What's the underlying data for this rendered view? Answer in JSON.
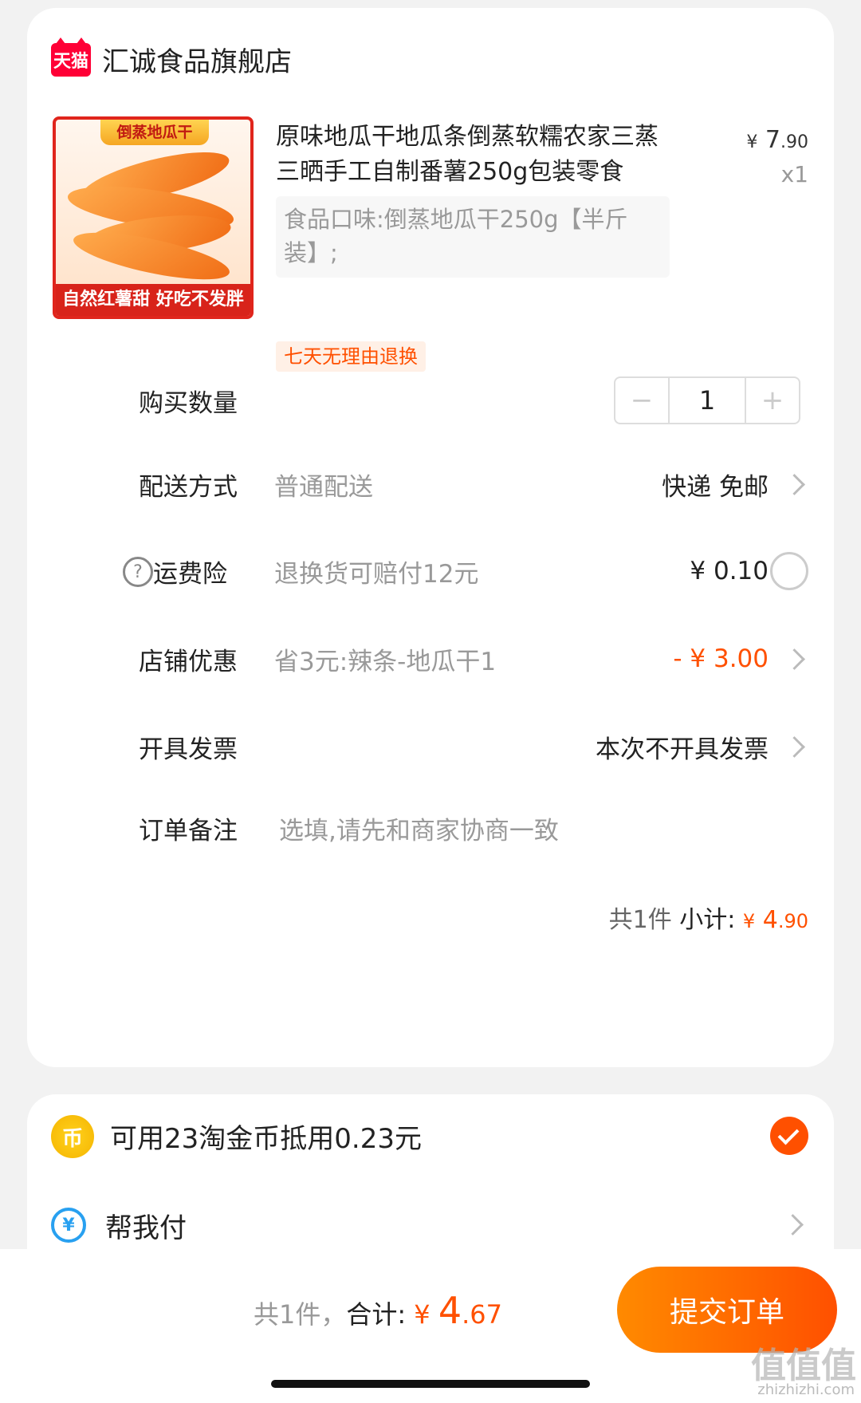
{
  "store": {
    "badge": "天猫",
    "name": "汇诚食品旗舰店"
  },
  "product": {
    "image_top_text": "倒蒸地瓜干",
    "image_bottom_text": "自然红薯甜 好吃不发胖",
    "title": "原味地瓜干地瓜条倒蒸软糯农家三蒸三晒手工自制番薯250g包装零食",
    "price_symbol": "¥",
    "price_int": "7",
    "price_dec": ".90",
    "quantity_label": "x1",
    "sku": "食品口味:倒蒸地瓜干250g【半斤装】;",
    "tag": "七天无理由退换"
  },
  "rows": {
    "quantity": {
      "label": "购买数量",
      "minus": "−",
      "value": "1",
      "plus": "+"
    },
    "delivery": {
      "label": "配送方式",
      "sub": "普通配送",
      "value": "快递 免邮"
    },
    "insurance": {
      "icon": "?",
      "label": "运费险",
      "sub": "退换货可赔付12元",
      "value": "¥ 0.10"
    },
    "discount": {
      "label": "店铺优惠",
      "sub": "省3元:辣条-地瓜干1",
      "value": "- ¥ 3.00"
    },
    "invoice": {
      "label": "开具发票",
      "value": "本次不开具发票"
    },
    "note": {
      "label": "订单备注",
      "placeholder": "选填,请先和商家协商一致"
    }
  },
  "subtotal": {
    "count": "共1件",
    "label": "小计:",
    "symbol": "¥",
    "int": "4",
    "dec": ".90"
  },
  "coins": {
    "icon_text": "币",
    "text": "可用23淘金币抵用0.23元"
  },
  "help_pay": {
    "icon_text": "¥",
    "text": "帮我付"
  },
  "footer": {
    "count": "共1件，",
    "total_label": "合计:",
    "symbol": "¥",
    "int": "4",
    "dec": ".67",
    "submit": "提交订单"
  },
  "watermark": {
    "text": "值值值",
    "url": "zhizhizhi.com"
  },
  "colors": {
    "accent": "#ff5000",
    "tmall": "#ff0036",
    "background": "#f2f2f2"
  }
}
